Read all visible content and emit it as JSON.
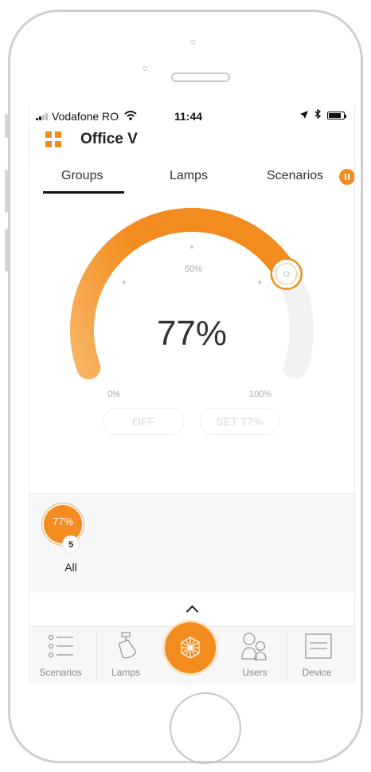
{
  "statusbar": {
    "carrier": "Vodafone RO",
    "time": "11:44"
  },
  "header": {
    "title": "Office V",
    "menu_icon": "grid-menu-icon"
  },
  "tabs": [
    {
      "label": "Groups",
      "active": true
    },
    {
      "label": "Lamps",
      "active": false
    },
    {
      "label": "Scenarios",
      "active": false,
      "badge_icon": "pause-icon"
    }
  ],
  "dial": {
    "value_text": "77%",
    "level": 0.77,
    "mid_label": "50%",
    "min_label": "0%",
    "max_label": "100%",
    "off_label": "OFF",
    "set_label": "SET 77%",
    "accent_color": "#f28c1e"
  },
  "groups": [
    {
      "label": "All",
      "percent": "77%",
      "count": "5"
    }
  ],
  "nav": {
    "items": [
      {
        "label": "Scenarios",
        "icon": "scenario-list-icon"
      },
      {
        "label": "Lamps",
        "icon": "lamp-icon"
      },
      {
        "label": "",
        "icon": "network-hub-icon"
      },
      {
        "label": "Users",
        "icon": "users-icon"
      },
      {
        "label": "Device",
        "icon": "device-icon"
      }
    ]
  }
}
